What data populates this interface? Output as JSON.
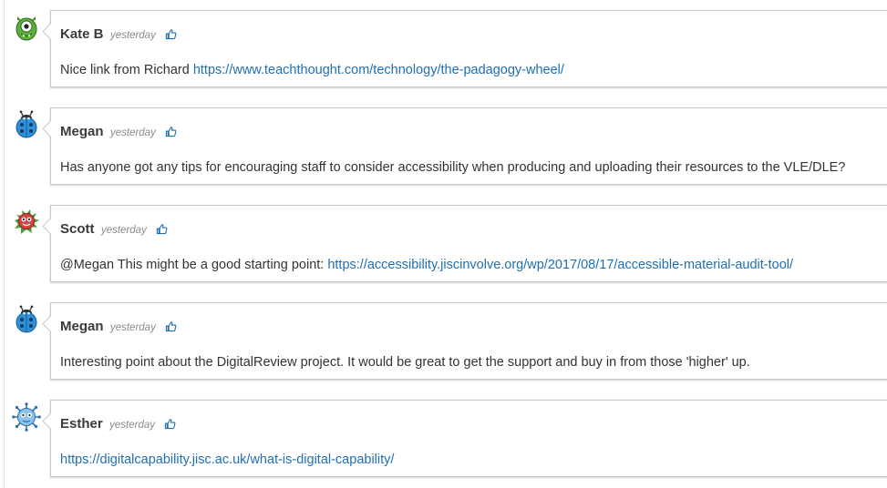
{
  "colors": {
    "link": "#1f6fb2",
    "name": "#3a3a3a",
    "timestamp": "#8a8a8a",
    "card_border": "#c9c9c9"
  },
  "comments": [
    {
      "author": "Kate B",
      "time": "yesterday",
      "avatar": "green-monster-icon",
      "like_icon": "thumbs-up-icon",
      "text": "Nice link from Richard ",
      "link": "https://www.teachthought.com/technology/the-padagogy-wheel/"
    },
    {
      "author": "Megan",
      "time": "yesterday",
      "avatar": "blue-ladybug-icon",
      "like_icon": "thumbs-up-icon",
      "text": "Has anyone got any tips for encouraging staff to consider accessibility when producing and uploading their resources to the VLE/DLE?"
    },
    {
      "author": "Scott",
      "time": "yesterday",
      "avatar": "red-blob-monster-icon",
      "like_icon": "thumbs-up-icon",
      "text": "@Megan This might be a good starting point: ",
      "link": "https://accessibility.jiscinvolve.org/wp/2017/08/17/accessible-material-audit-tool/"
    },
    {
      "author": "Megan",
      "time": "yesterday",
      "avatar": "blue-ladybug-icon",
      "like_icon": "thumbs-up-icon",
      "text": "Interesting point about the DigitalReview project. It would be great to get the support and buy in from those 'higher' up."
    },
    {
      "author": "Esther",
      "time": "yesterday",
      "avatar": "blue-virus-monster-icon",
      "like_icon": "thumbs-up-icon",
      "link": "https://digitalcapability.jisc.ac.uk/what-is-digital-capability/"
    }
  ]
}
